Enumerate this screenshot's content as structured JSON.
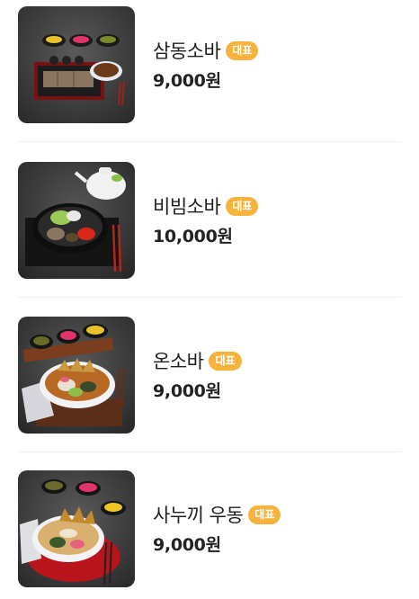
{
  "menu": {
    "items": [
      {
        "name": "삼동소바",
        "badge": "대표",
        "price": "9,000원"
      },
      {
        "name": "비빔소바",
        "badge": "대표",
        "price": "10,000원"
      },
      {
        "name": "온소바",
        "badge": "대표",
        "price": "9,000원"
      },
      {
        "name": "사누끼 우동",
        "badge": "대표",
        "price": "9,000원"
      }
    ]
  },
  "colors": {
    "badge_bg": "#f7b33b",
    "badge_text": "#ffffff",
    "divider": "#f0f0f0",
    "photo_bg": "#3a3a3a"
  }
}
